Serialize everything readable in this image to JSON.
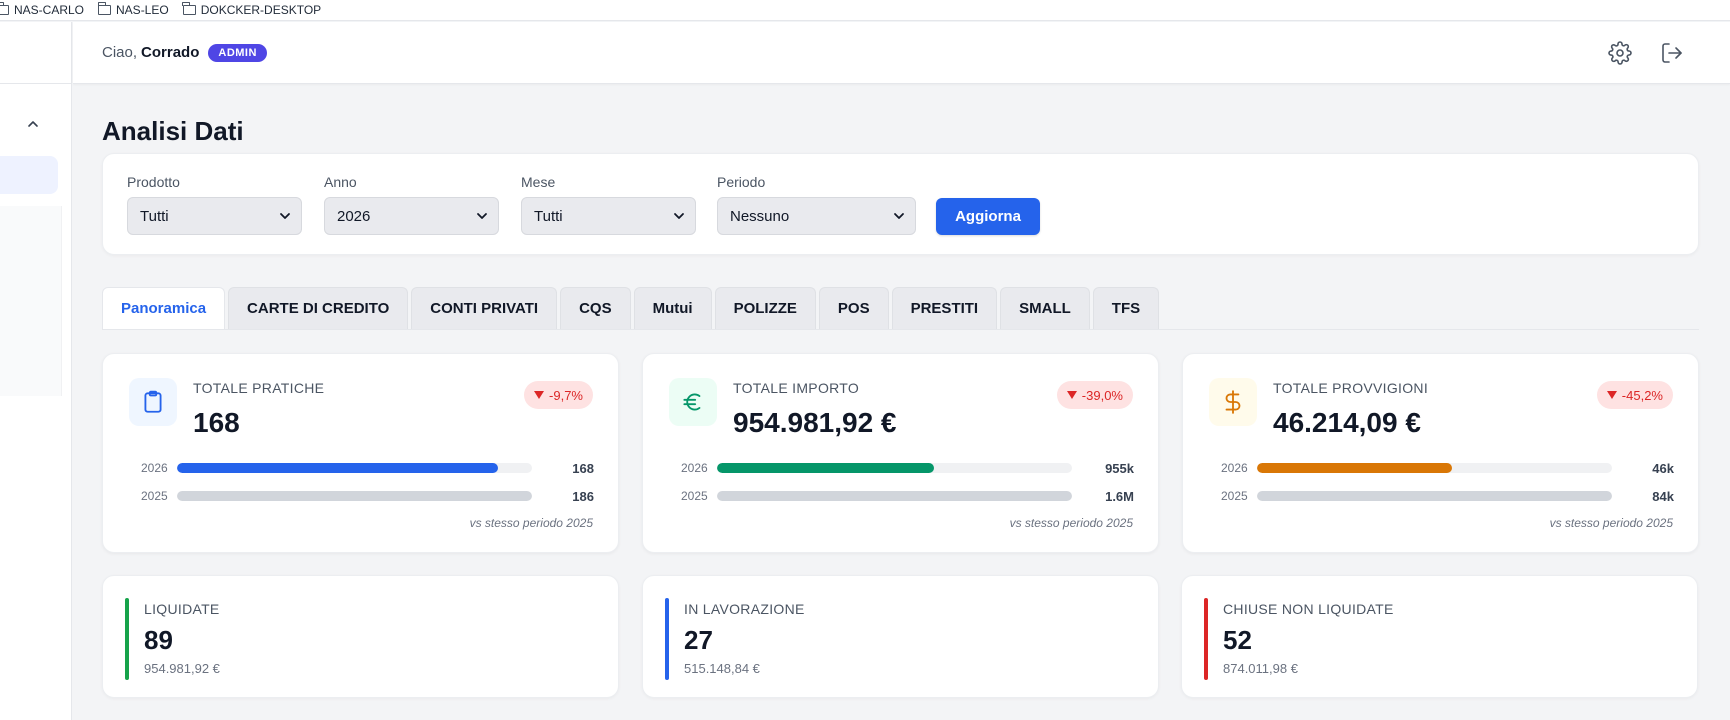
{
  "bookmarks": [
    {
      "label": "NAS-CARLO",
      "icon": "folder-icon"
    },
    {
      "label": "NAS-LEO",
      "icon": "folder-icon"
    },
    {
      "label": "DOKCKER-DESKTOP",
      "icon": "folder-icon"
    }
  ],
  "header": {
    "greeting": "Ciao,",
    "user_name": "Corrado",
    "role_badge": "ADMIN",
    "icons": [
      "gear-icon",
      "logout-icon"
    ]
  },
  "page": {
    "title": "Analisi Dati"
  },
  "filters": {
    "prodotto": {
      "label": "Prodotto",
      "value": "Tutti"
    },
    "anno": {
      "label": "Anno",
      "value": "2026"
    },
    "mese": {
      "label": "Mese",
      "value": "Tutti"
    },
    "periodo": {
      "label": "Periodo",
      "value": "Nessuno"
    },
    "submit_label": "Aggiorna"
  },
  "tabs": [
    {
      "label": "Panoramica",
      "active": true
    },
    {
      "label": "CARTE DI CREDITO",
      "active": false
    },
    {
      "label": "CONTI PRIVATI",
      "active": false
    },
    {
      "label": "CQS",
      "active": false
    },
    {
      "label": "Mutui",
      "active": false
    },
    {
      "label": "POLIZZE",
      "active": false
    },
    {
      "label": "POS",
      "active": false
    },
    {
      "label": "PRESTITI",
      "active": false
    },
    {
      "label": "SMALL",
      "active": false
    },
    {
      "label": "TFS",
      "active": false
    }
  ],
  "kpis": [
    {
      "label": "TOTALE PRATICHE",
      "value": "168",
      "delta": "-9,7%",
      "icon": "clipboard-icon",
      "color": "#2563eb",
      "icon_bg": "#eff6ff",
      "rows": [
        {
          "year": "2026",
          "value": "168",
          "fraction": 0.903
        },
        {
          "year": "2025",
          "value": "186",
          "fraction": 1.0
        }
      ],
      "note": "vs stesso periodo 2025"
    },
    {
      "label": "TOTALE IMPORTO",
      "value": "954.981,92 €",
      "delta": "-39,0%",
      "icon": "euro-icon",
      "color": "#059669",
      "icon_bg": "#ecfdf5",
      "rows": [
        {
          "year": "2026",
          "value": "955k",
          "fraction": 0.61
        },
        {
          "year": "2025",
          "value": "1.6M",
          "fraction": 1.0
        }
      ],
      "note": "vs stesso periodo 2025"
    },
    {
      "label": "TOTALE PROVVIGIONI",
      "value": "46.214,09 €",
      "delta": "-45,2%",
      "icon": "dollar-icon",
      "color": "#d97706",
      "icon_bg": "#fffbeb",
      "rows": [
        {
          "year": "2026",
          "value": "46k",
          "fraction": 0.548
        },
        {
          "year": "2025",
          "value": "84k",
          "fraction": 1.0
        }
      ],
      "note": "vs stesso periodo 2025"
    }
  ],
  "status_cards": [
    {
      "label": "LIQUIDATE",
      "value": "89",
      "amount": "954.981,92 €",
      "color": "#16a34a"
    },
    {
      "label": "IN LAVORAZIONE",
      "value": "27",
      "amount": "515.148,84 €",
      "color": "#2563eb"
    },
    {
      "label": "CHIUSE NON LIQUIDATE",
      "value": "52",
      "amount": "874.011,98 €",
      "color": "#dc2626"
    }
  ],
  "colors": {
    "primary": "#2563eb",
    "admin_badge": "#4f46e5",
    "neutral_bar": "#d1d5db",
    "negative": "#dc2626"
  }
}
